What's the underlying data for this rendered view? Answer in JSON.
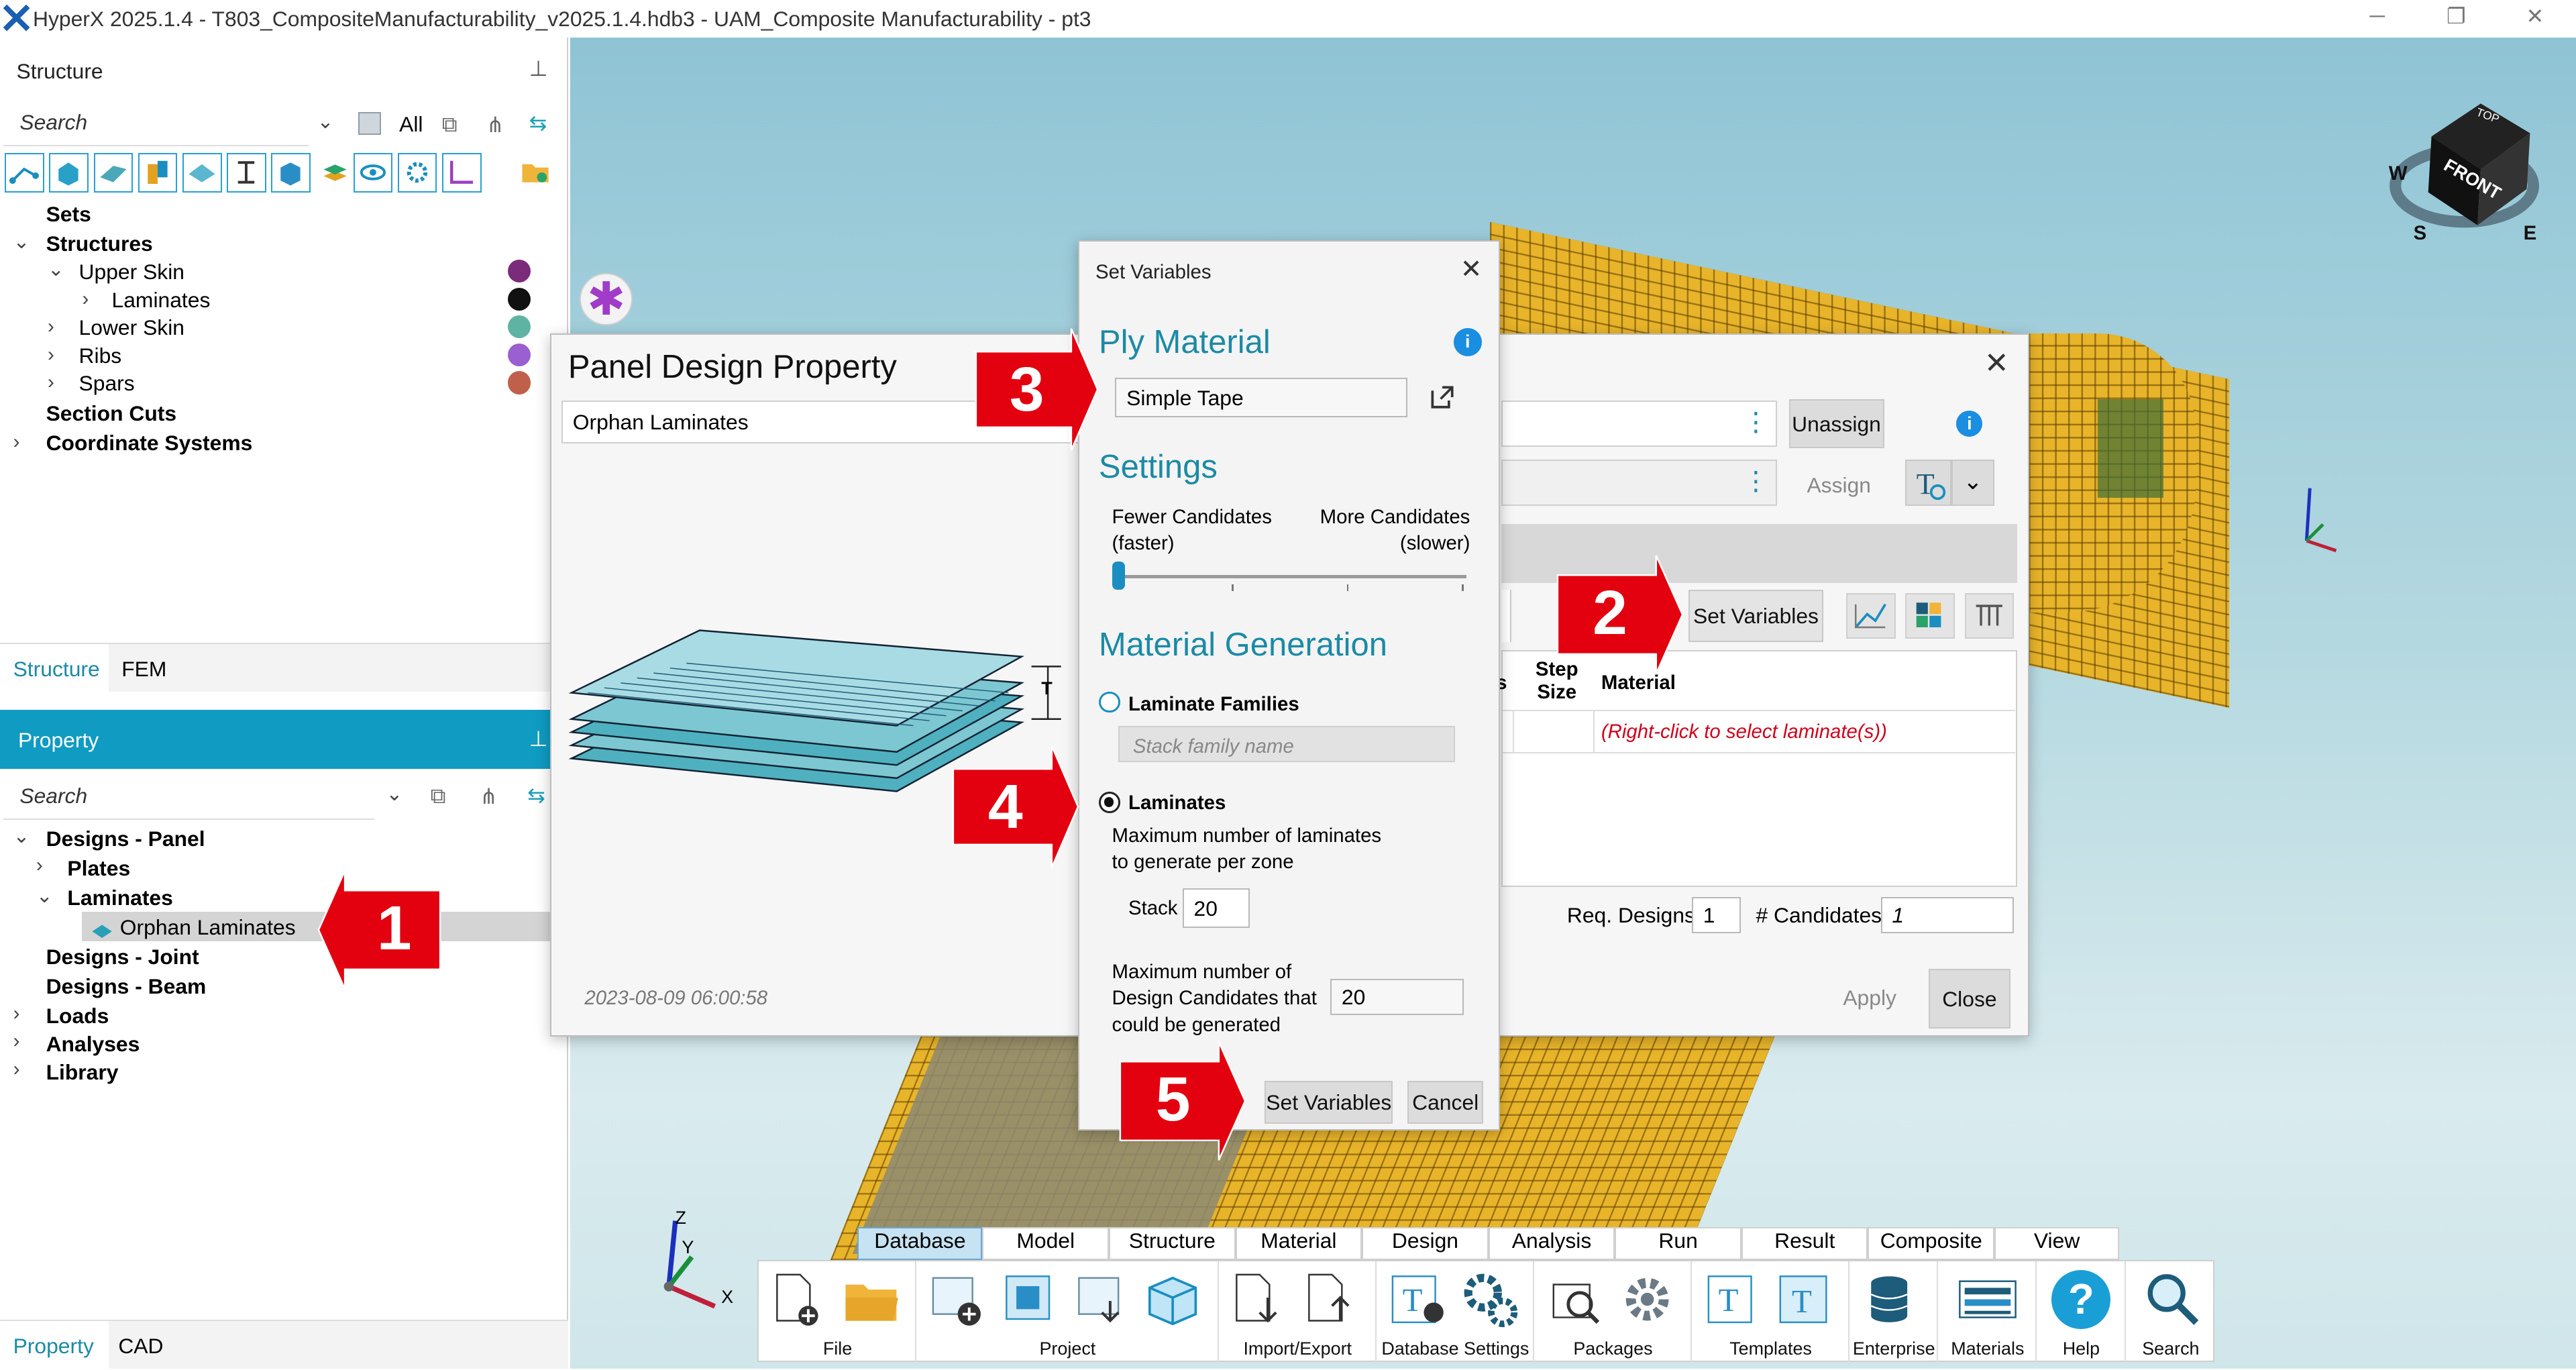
{
  "window": {
    "title": "HyperX 2025.1.4 - T803_CompositeManufacturability_v2025.1.4.hdb3 - UAM_Composite Manufacturability - pt3",
    "controls": [
      "minimize",
      "restore",
      "close"
    ]
  },
  "structure_pane": {
    "header": "Structure",
    "search_placeholder": "Search",
    "filter_label": "All",
    "tree": [
      {
        "label": "Sets",
        "bold": true
      },
      {
        "label": "Structures",
        "bold": true
      },
      {
        "label": "Upper Skin",
        "color": "#7a2b7a"
      },
      {
        "label": "Laminates",
        "color": "#111111"
      },
      {
        "label": "Lower Skin",
        "color": "#5fb3a3"
      },
      {
        "label": "Ribs",
        "color": "#9a5fd0"
      },
      {
        "label": "Spars",
        "color": "#c0604a"
      },
      {
        "label": "Section Cuts",
        "bold": true
      },
      {
        "label": "Coordinate Systems",
        "bold": true
      }
    ],
    "tabs": [
      "Structure",
      "FEM"
    ]
  },
  "property_pane": {
    "header": "Property",
    "search_placeholder": "Search",
    "tree": [
      {
        "label": "Designs - Panel",
        "bold": true
      },
      {
        "label": "Plates",
        "bold": true
      },
      {
        "label": "Laminates",
        "bold": true
      },
      {
        "label": "Orphan Laminates",
        "selected": true
      },
      {
        "label": "Designs - Joint",
        "bold": true
      },
      {
        "label": "Designs - Beam",
        "bold": true
      },
      {
        "label": "Loads",
        "bold": true
      },
      {
        "label": "Analyses",
        "bold": true
      },
      {
        "label": "Library",
        "bold": true
      }
    ],
    "tabs": [
      "Property",
      "CAD"
    ]
  },
  "panel_design_dialog": {
    "title": "Panel Design Property",
    "name_field": "Orphan Laminates",
    "diagram_label": "T",
    "timestamp": "2023-08-09 06:00:58",
    "unassign_label": "Unassign",
    "assign_label": "Assign",
    "set_variables_label": "Set Variables",
    "table_headers": [
      "s",
      "Step Size",
      "Material"
    ],
    "table_hint": "(Right-click to select laminate(s))",
    "req_designs_label": "Req. Designs",
    "req_designs_value": "1",
    "candidates_label": "# Candidates",
    "candidates_value": "1",
    "apply_label": "Apply",
    "close_label": "Close"
  },
  "set_variables_dialog": {
    "title": "Set Variables",
    "ply_material_heading": "Ply Material",
    "ply_material_value": "Simple Tape",
    "settings_heading": "Settings",
    "fewer_candidates": "Fewer Candidates",
    "fewer_sub": "(faster)",
    "more_candidates": "More Candidates",
    "more_sub": "(slower)",
    "slider_level": 0,
    "material_generation_heading": "Material Generation",
    "option_families": "Laminate Families",
    "family_placeholder": "Stack family name",
    "option_laminates": "Laminates",
    "selected_option": "Laminates",
    "max_laminates_label_1": "Maximum number of laminates",
    "max_laminates_label_2": "to generate per zone",
    "stack_label": "Stack",
    "stack_value": "20",
    "max_candidates_label_1": "Maximum number of",
    "max_candidates_label_2": "Design Candidates that",
    "max_candidates_label_3": "could be generated",
    "max_candidates_value": "20",
    "set_variables_button": "Set Variables",
    "cancel_button": "Cancel"
  },
  "callouts": [
    "1",
    "2",
    "3",
    "4",
    "5"
  ],
  "view_cube": {
    "face": "FRONT",
    "top": "TOP",
    "compass": [
      "W",
      "S",
      "E"
    ]
  },
  "triad": {
    "z": "Z",
    "y": "Y",
    "x": "X"
  },
  "ribbon": {
    "tabs": [
      "Database",
      "Model",
      "Structure",
      "Material",
      "Design",
      "Analysis",
      "Run",
      "Result",
      "Composite",
      "View"
    ],
    "active_tab": "Database",
    "groups": [
      "File",
      "Project",
      "Import/Export",
      "Database Settings",
      "Packages",
      "Templates",
      "Enterprise",
      "Materials",
      "Help",
      "Search"
    ]
  },
  "colors": {
    "accent": "#0f9bc2",
    "teal_heading": "#1b8aa6",
    "mesh": "#e8b42a",
    "callout": "#e3000f",
    "hint_red": "#d0021b"
  }
}
